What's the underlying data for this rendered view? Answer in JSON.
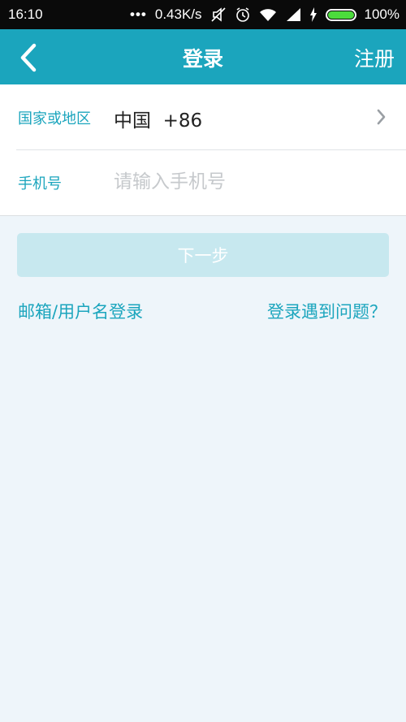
{
  "status_bar": {
    "time": "16:10",
    "network_speed": "0.43K/s",
    "battery_percent": "100%",
    "battery_level": 1.0,
    "icons": [
      "more-icon",
      "mute-icon",
      "alarm-icon",
      "wifi-icon",
      "signal-icon",
      "charging-icon",
      "battery-icon"
    ]
  },
  "app_bar": {
    "title": "登录",
    "register_label": "注册",
    "back_icon": "chevron-left-icon"
  },
  "form": {
    "country_label": "国家或地区",
    "country_value": "中国  +86",
    "phone_label": "手机号",
    "phone_placeholder": "请输入手机号",
    "phone_value": ""
  },
  "actions": {
    "next_label": "下一步",
    "email_login_label": "邮箱/用户名登录",
    "help_label": "登录遇到问题？"
  },
  "colors": {
    "accent": "#1ba5bd",
    "disabled_button": "#c7e8ef",
    "background": "#eef5fa"
  }
}
